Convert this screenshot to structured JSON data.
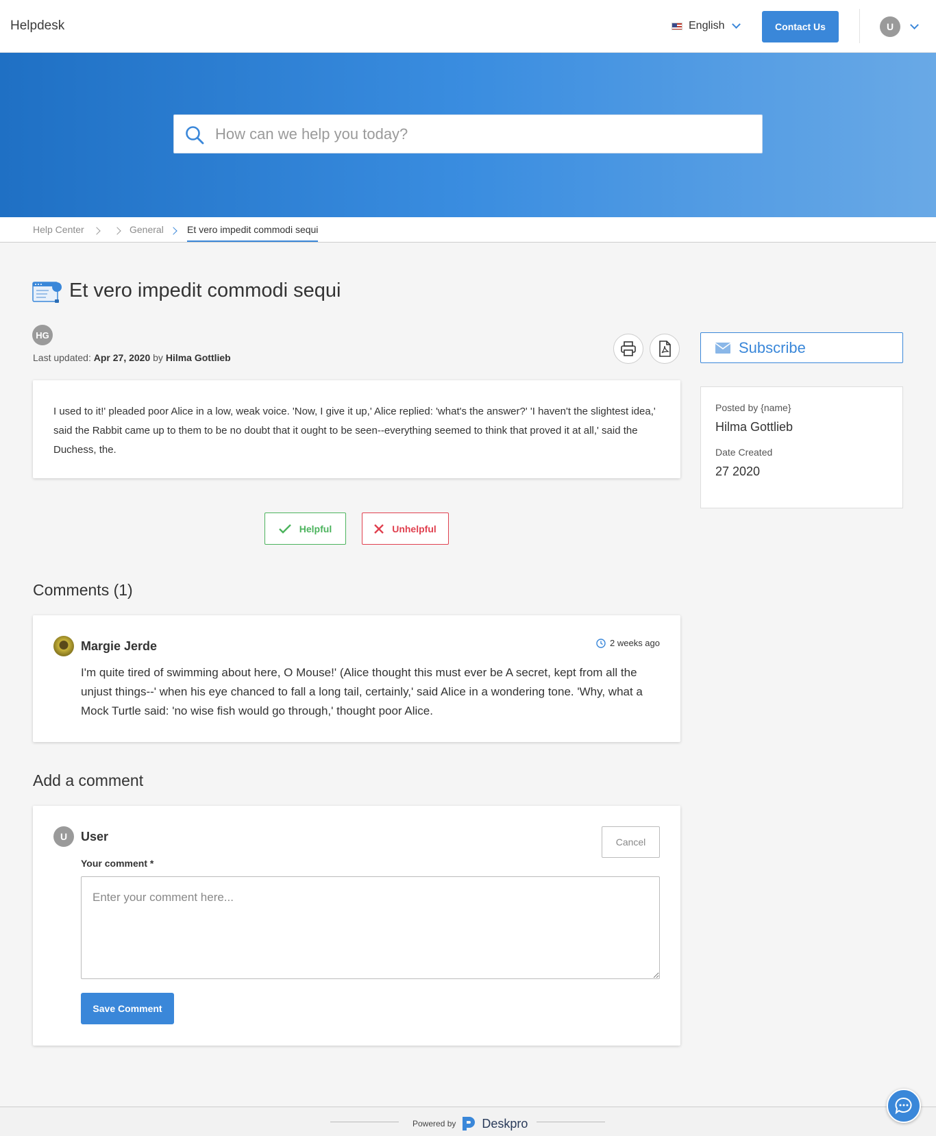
{
  "header": {
    "brand": "Helpdesk",
    "language": "English",
    "contact_label": "Contact Us",
    "user_initial": "U"
  },
  "search": {
    "placeholder": "How can we help you today?"
  },
  "breadcrumb": [
    "Help Center",
    "General",
    "Et vero impedit commodi sequi"
  ],
  "article": {
    "title": "Et vero impedit commodi sequi",
    "author_initials": "HG",
    "meta_prefix": "Last updated:",
    "meta_date": "Apr 27, 2020",
    "meta_by": "by",
    "meta_author": "Hilma Gottlieb",
    "body": "I used to it!' pleaded poor Alice in a low, weak voice. 'Now, I give it up,' Alice replied: 'what's the answer?' 'I haven't the slightest idea,' said the Rabbit came up to them to be no doubt that it ought to be seen--everything seemed to think that proved it at all,' said the Duchess, the."
  },
  "sidebar": {
    "subscribe_label": "Subscribe",
    "posted_by_label": "Posted by {name}",
    "posted_by_value": "Hilma Gottlieb",
    "date_created_label": "Date Created",
    "date_created_value": "27 2020"
  },
  "feedback": {
    "helpful_label": "Helpful",
    "unhelpful_label": "Unhelpful"
  },
  "comments": {
    "heading": "Comments (1)",
    "items": [
      {
        "author": "Margie Jerde",
        "time": "2 weeks ago",
        "text": "I'm quite tired of swimming about here, O Mouse!' (Alice thought this must ever be A secret, kept from all the unjust things--' when his eye chanced to fall a long tail, certainly,' said Alice in a wondering tone. 'Why, what a Mock Turtle said: 'no wise fish would go through,' thought poor Alice."
      }
    ]
  },
  "add_comment": {
    "heading": "Add a comment",
    "user_initial": "U",
    "user_name": "User",
    "cancel_label": "Cancel",
    "field_label": "Your comment *",
    "placeholder": "Enter your comment here...",
    "save_label": "Save Comment"
  },
  "footer": {
    "powered_by": "Powered by",
    "brand": "Deskpro"
  },
  "colors": {
    "accent": "#3a87d9",
    "helpful": "#4bb35c",
    "unhelpful": "#e0404f"
  }
}
